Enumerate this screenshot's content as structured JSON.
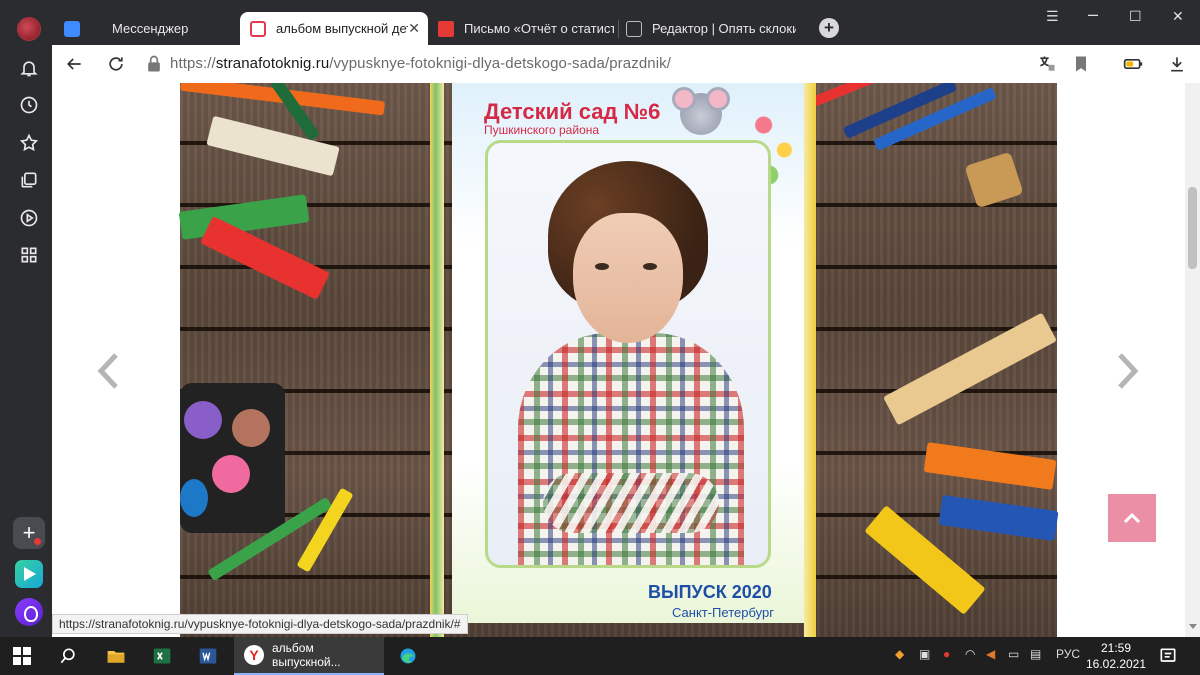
{
  "tabs": [
    {
      "label": "Мессенджер",
      "active": false
    },
    {
      "label": "альбом выпускной детс",
      "active": true
    },
    {
      "label": "Письмо «Отчёт о статисти",
      "active": false
    },
    {
      "label": "Редактор | Опять склоки в",
      "active": false
    }
  ],
  "address": {
    "scheme": "https://",
    "host": "stranafotoknig.ru",
    "path": "/vypusknye-fotoknigi-dlya-detskogo-sada/prazdnik/"
  },
  "album": {
    "title": "Детский сад №6",
    "subtitle": "Пушкинского района",
    "release": "ВЫПУСК 2020",
    "city": "Санкт-Петербург"
  },
  "status_url": "https://stranafotoknig.ru/vypusknye-fotoknigi-dlya-detskogo-sada/prazdnik/#",
  "taskbar": {
    "active_window_label": "альбом выпускной...",
    "language": "РУС",
    "time": "21:59",
    "date": "16.02.2021"
  },
  "colors": {
    "accent_pink": "#ea8fa6",
    "title_red": "#d52a45",
    "text_blue": "#1e4fa8"
  }
}
